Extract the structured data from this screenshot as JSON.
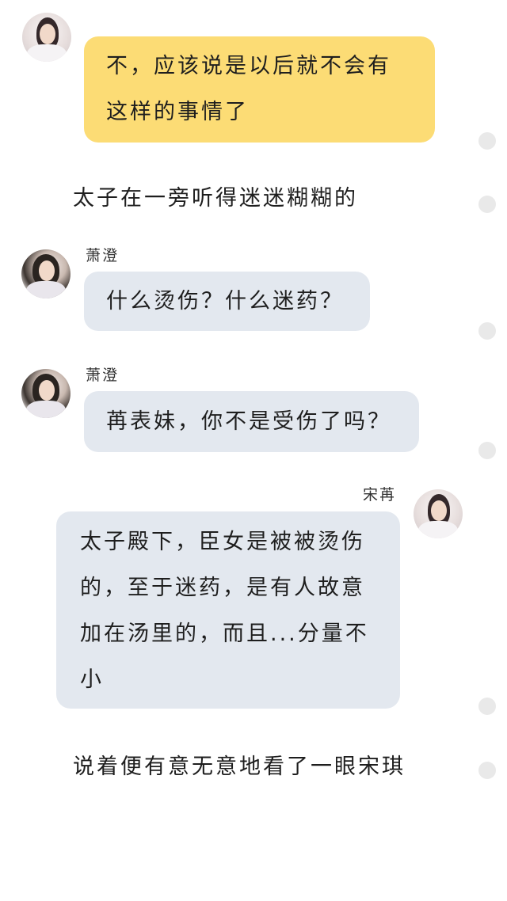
{
  "messages": [
    {
      "speaker": "",
      "text": "不，应该说是以后就不会有这样的事情了"
    },
    {
      "narration": "太子在一旁听得迷迷糊糊的"
    },
    {
      "speaker": "萧澄",
      "text": "什么烫伤？什么迷药？"
    },
    {
      "speaker": "萧澄",
      "text": "苒表妹，你不是受伤了吗？"
    },
    {
      "speaker": "宋苒",
      "text": "太子殿下，臣女是被被烫伤的，至于迷药，是有人故意加在汤里的，而且...分量不小"
    },
    {
      "narration": "说着便有意无意地看了一眼宋琪"
    }
  ],
  "msg1_line1": "不，应该说是以后就不会有",
  "msg1_line2": "这样的事情了",
  "narration1": "太子在一旁听得迷迷糊糊的",
  "msg2_name": "萧澄",
  "msg2_text": "什么烫伤？什么迷药？",
  "msg3_name": "萧澄",
  "msg3_text": "苒表妹，你不是受伤了吗？",
  "msg4_name": "宋苒",
  "msg4_line1": "太子殿下，臣女是被被烫伤",
  "msg4_line2": "的，至于迷药，是有人故意",
  "msg4_line3": "加在汤里的，而且...分量不",
  "msg4_line4": "小",
  "narration2": "说着便有意无意地看了一眼宋琪",
  "colors": {
    "yellow_bubble": "#fcdc75",
    "grey_bubble": "#e3e8ef"
  }
}
